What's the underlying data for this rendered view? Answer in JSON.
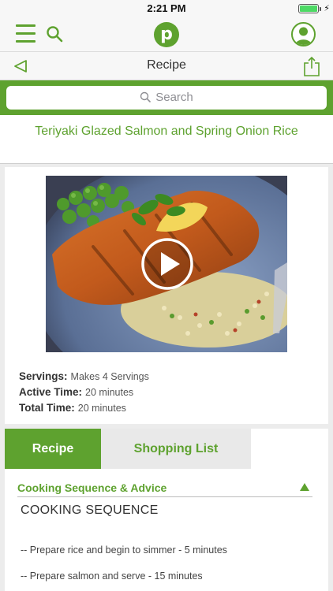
{
  "status_bar": {
    "time": "2:21 PM",
    "battery_level": 1.0,
    "charging": true
  },
  "top_nav": {
    "logo_letter": "p",
    "icons": [
      "menu-icon",
      "search-icon",
      "logo-icon",
      "profile-icon"
    ]
  },
  "sub_nav": {
    "title": "Recipe",
    "icons": [
      "back-icon",
      "share-icon"
    ]
  },
  "search": {
    "placeholder": "Search"
  },
  "recipe": {
    "title": "Teriyaki Glazed Salmon and Spring Onion Rice",
    "servings_label": "Servings:",
    "servings_value": "Makes 4 Servings",
    "active_label": "Active Time:",
    "active_value": "20 minutes",
    "total_label": "Total Time:",
    "total_value": "20 minutes"
  },
  "tabs": [
    {
      "label": "Recipe",
      "active": true
    },
    {
      "label": "Shopping List",
      "active": false
    }
  ],
  "content": {
    "section_title": "Cooking Sequence & Advice",
    "heading": "COOKING SEQUENCE",
    "steps": [
      "-- Prepare rice and begin to simmer - 5 minutes",
      "-- Prepare salmon and serve - 15 minutes"
    ]
  },
  "colors": {
    "brand_green": "#5ea22f",
    "background": "#ececec"
  }
}
